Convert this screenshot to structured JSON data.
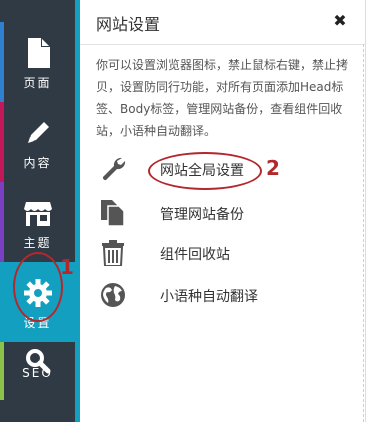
{
  "sidebar": {
    "items": [
      {
        "label": "页面",
        "icon": "page-icon",
        "accent": "#2f80d0"
      },
      {
        "label": "内容",
        "icon": "pencil-icon",
        "accent": "#c2185b"
      },
      {
        "label": "主题",
        "icon": "store-icon",
        "accent": "#7b3fc4"
      },
      {
        "label": "设置",
        "icon": "gear-icon",
        "accent": "#13a0c0"
      },
      {
        "label": "SEO",
        "icon": "search-icon",
        "accent": "#8bc34a"
      }
    ],
    "active_color": "#13a0c0",
    "background": "#2f3a45"
  },
  "panel": {
    "title": "网站设置",
    "close_symbol": "✖",
    "description": "你可以设置浏览器图标，禁止鼠标右键，禁止拷贝，设置防同行功能，对所有页面添加Head标签、Body标签，管理网站备份，查看组件回收站，小语种自动翻译。",
    "menu": [
      {
        "label": "网站全局设置",
        "icon": "wrench-icon"
      },
      {
        "label": "管理网站备份",
        "icon": "backup-icon"
      },
      {
        "label": "组件回收站",
        "icon": "trash-icon"
      },
      {
        "label": "小语种自动翻译",
        "icon": "globe-icon"
      }
    ]
  },
  "annotations": {
    "step1": "1",
    "step2": "2",
    "color": "#b3282d"
  }
}
